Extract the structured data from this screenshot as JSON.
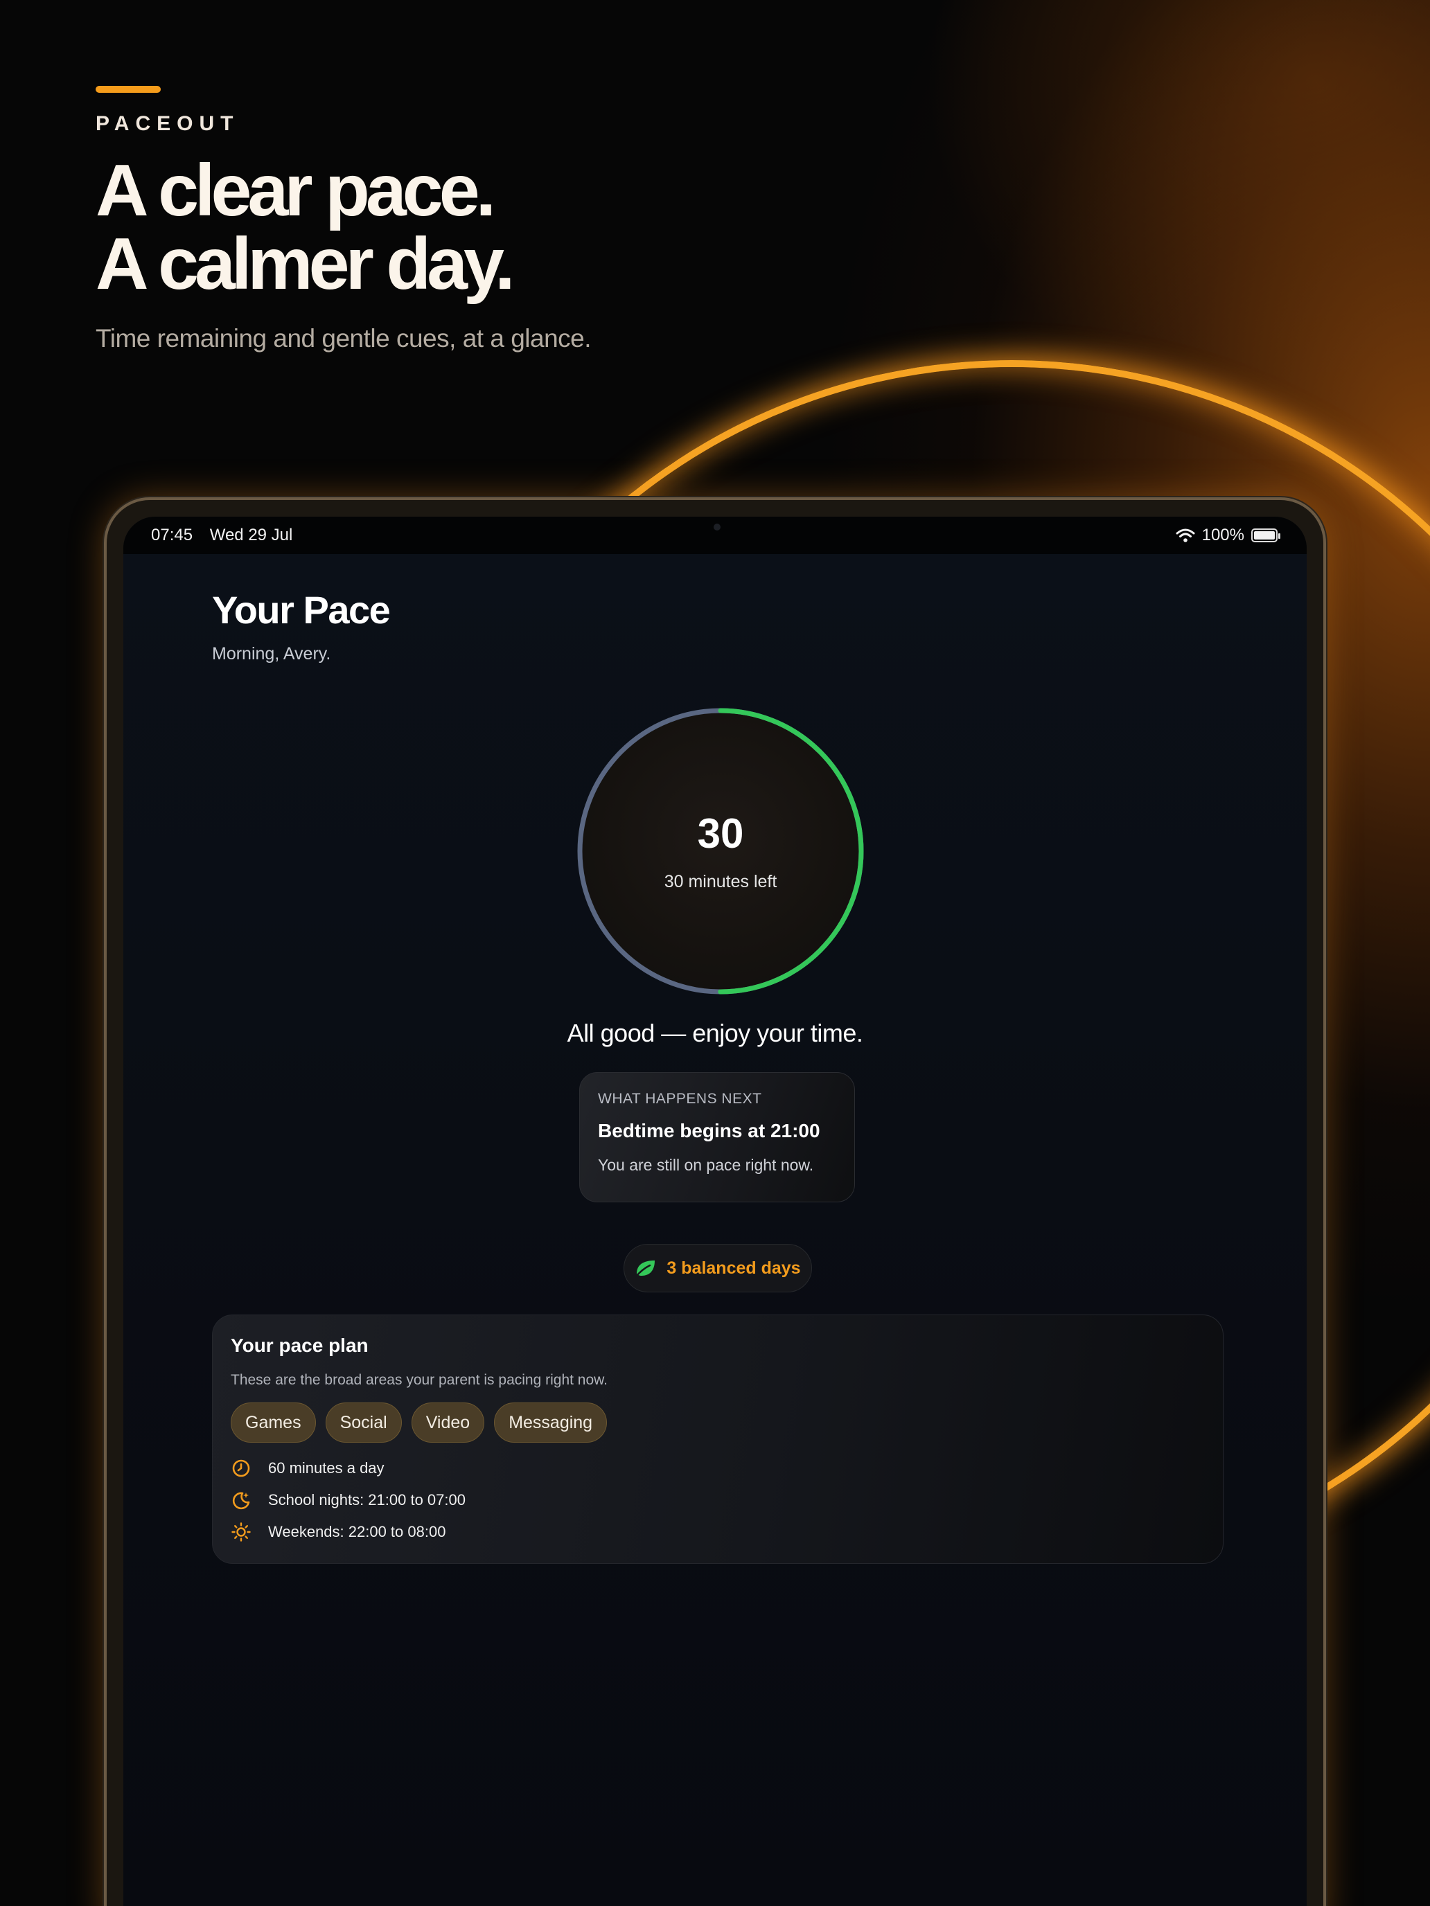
{
  "hero": {
    "brand": "PACEOUT",
    "headline_line1": "A clear pace.",
    "headline_line2": "A calmer day.",
    "subhead": "Time remaining and gentle cues, at a glance."
  },
  "statusbar": {
    "time": "07:45",
    "date": "Wed 29 Jul",
    "battery": "100%",
    "icons": [
      "wifi-icon",
      "battery-icon"
    ]
  },
  "screen": {
    "title": "Your Pace",
    "greeting": "Morning, Avery.",
    "ring": {
      "value": "30",
      "label": "30 minutes left",
      "remaining_fraction": 0.5,
      "colors": {
        "remaining": "#34c759",
        "used": "#5a6782"
      }
    },
    "status_message": "All good — enjoy your time.",
    "next_card": {
      "eyebrow": "WHAT HAPPENS NEXT",
      "title": "Bedtime begins at 21:00",
      "subtitle": "You are still on pace right now."
    },
    "streak": {
      "label": "3 balanced days",
      "icon": "leaf-icon"
    },
    "plan": {
      "title": "Your pace plan",
      "description": "These are the broad areas your parent is pacing right now.",
      "chips": [
        "Games",
        "Social",
        "Video",
        "Messaging"
      ],
      "rules": [
        {
          "icon": "clock-icon",
          "text": "60 minutes a day"
        },
        {
          "icon": "moon-icon",
          "text": "School nights: 21:00 to 07:00"
        },
        {
          "icon": "sun-icon",
          "text": "Weekends: 22:00 to 08:00"
        }
      ]
    }
  },
  "colors": {
    "accent": "#f59c1b",
    "background": "#060606",
    "screen": "#0a0d14"
  }
}
